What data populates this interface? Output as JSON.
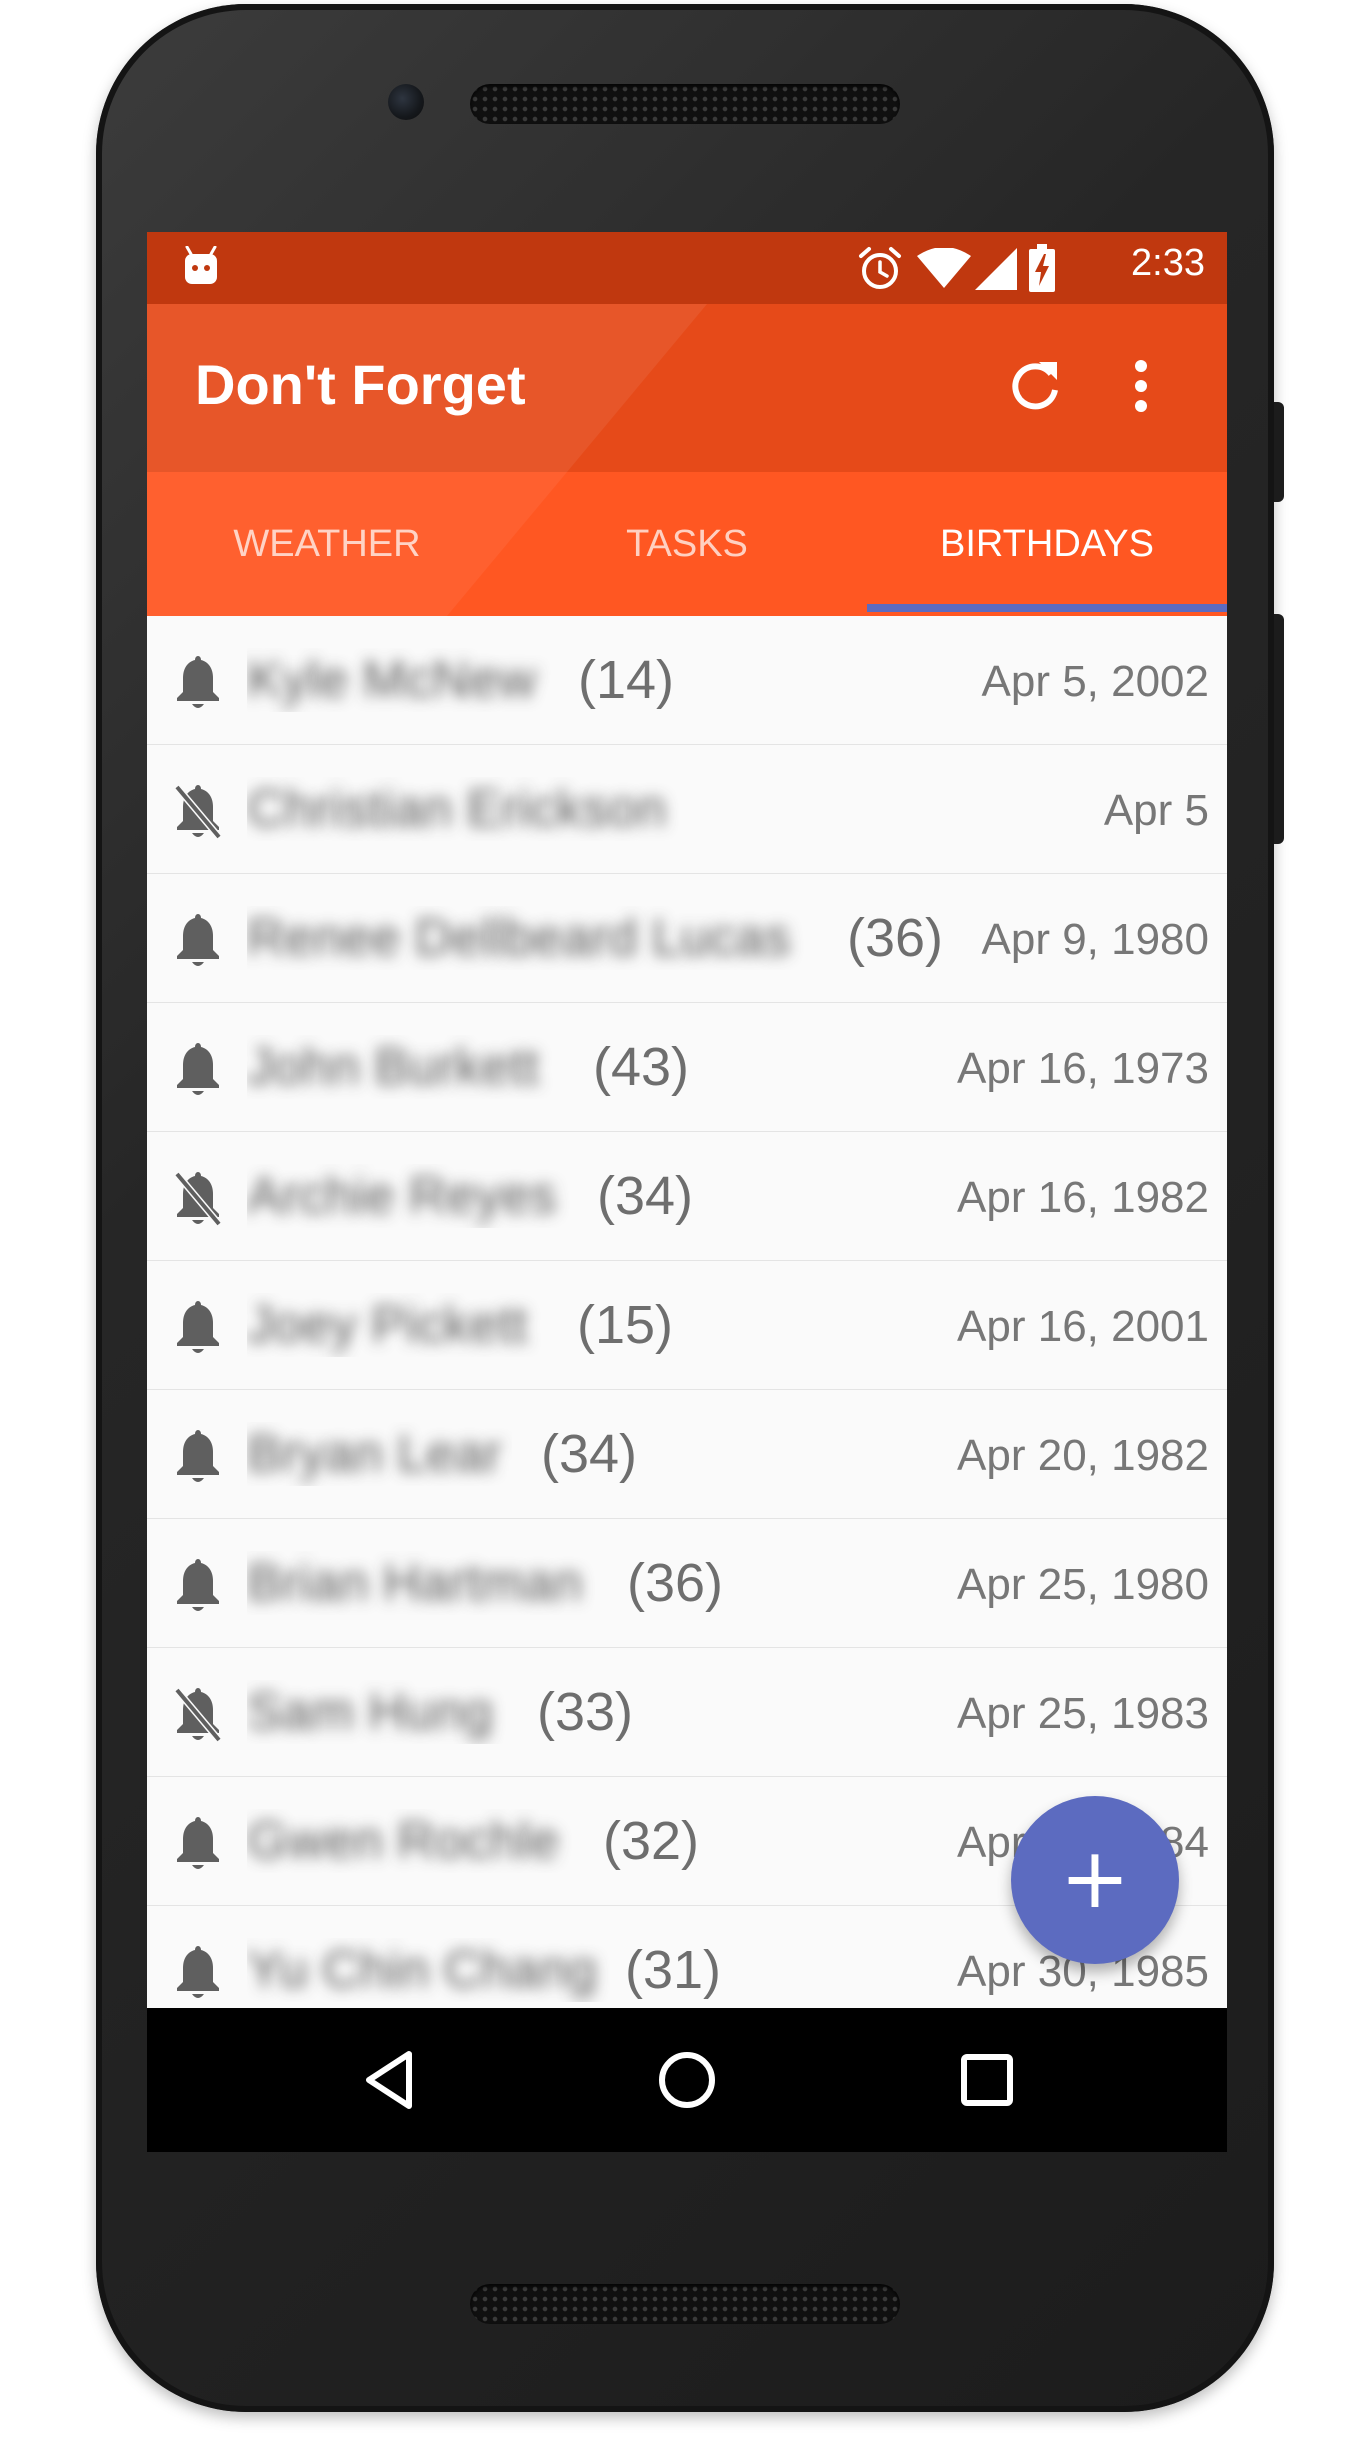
{
  "status_bar": {
    "time": "2:33",
    "icons": [
      "android-icon",
      "alarm-icon",
      "wifi-icon",
      "signal-icon",
      "battery-charging-icon"
    ]
  },
  "app_bar": {
    "title": "Don't Forget",
    "actions": [
      "refresh-icon",
      "more-vert-icon"
    ]
  },
  "tabs": [
    {
      "label": "WEATHER",
      "active": false
    },
    {
      "label": "TASKS",
      "active": false
    },
    {
      "label": "BIRTHDAYS",
      "active": true
    }
  ],
  "birthdays": [
    {
      "name": "Kyle McNew",
      "age": "(14)",
      "date": "Apr 5, 2002",
      "notify": true
    },
    {
      "name": "Christian Erickson",
      "age": "",
      "date": "Apr 5",
      "notify": false
    },
    {
      "name": "Renee Dellbeard Lucas",
      "age": "(36)",
      "date": "Apr 9, 1980",
      "notify": true
    },
    {
      "name": "John Burkett",
      "age": "(43)",
      "date": "Apr 16, 1973",
      "notify": true
    },
    {
      "name": "Archie Reyes",
      "age": "(34)",
      "date": "Apr 16, 1982",
      "notify": false
    },
    {
      "name": "Joey Pickett",
      "age": "(15)",
      "date": "Apr 16, 2001",
      "notify": true
    },
    {
      "name": "Bryan Lear",
      "age": "(34)",
      "date": "Apr 20, 1982",
      "notify": true
    },
    {
      "name": "Brian Hartman",
      "age": "(36)",
      "date": "Apr 25, 1980",
      "notify": true
    },
    {
      "name": "Sam Hung",
      "age": "(33)",
      "date": "Apr 25, 1983",
      "notify": false
    },
    {
      "name": "Gwen Rochle",
      "age": "(32)",
      "date": "Apr 28, 1984",
      "notify": true
    },
    {
      "name": "Yu Chin Chang",
      "age": "(31)",
      "date": "Apr 30, 1985",
      "notify": true
    }
  ],
  "fab": {
    "label": "+"
  },
  "nav_bar": [
    "back-icon",
    "home-icon",
    "recents-icon"
  ],
  "colors": {
    "status_bar": "#c0380f",
    "app_bar": "#e64a19",
    "tab_bar": "#ff5722",
    "accent": "#5c6bc0"
  }
}
